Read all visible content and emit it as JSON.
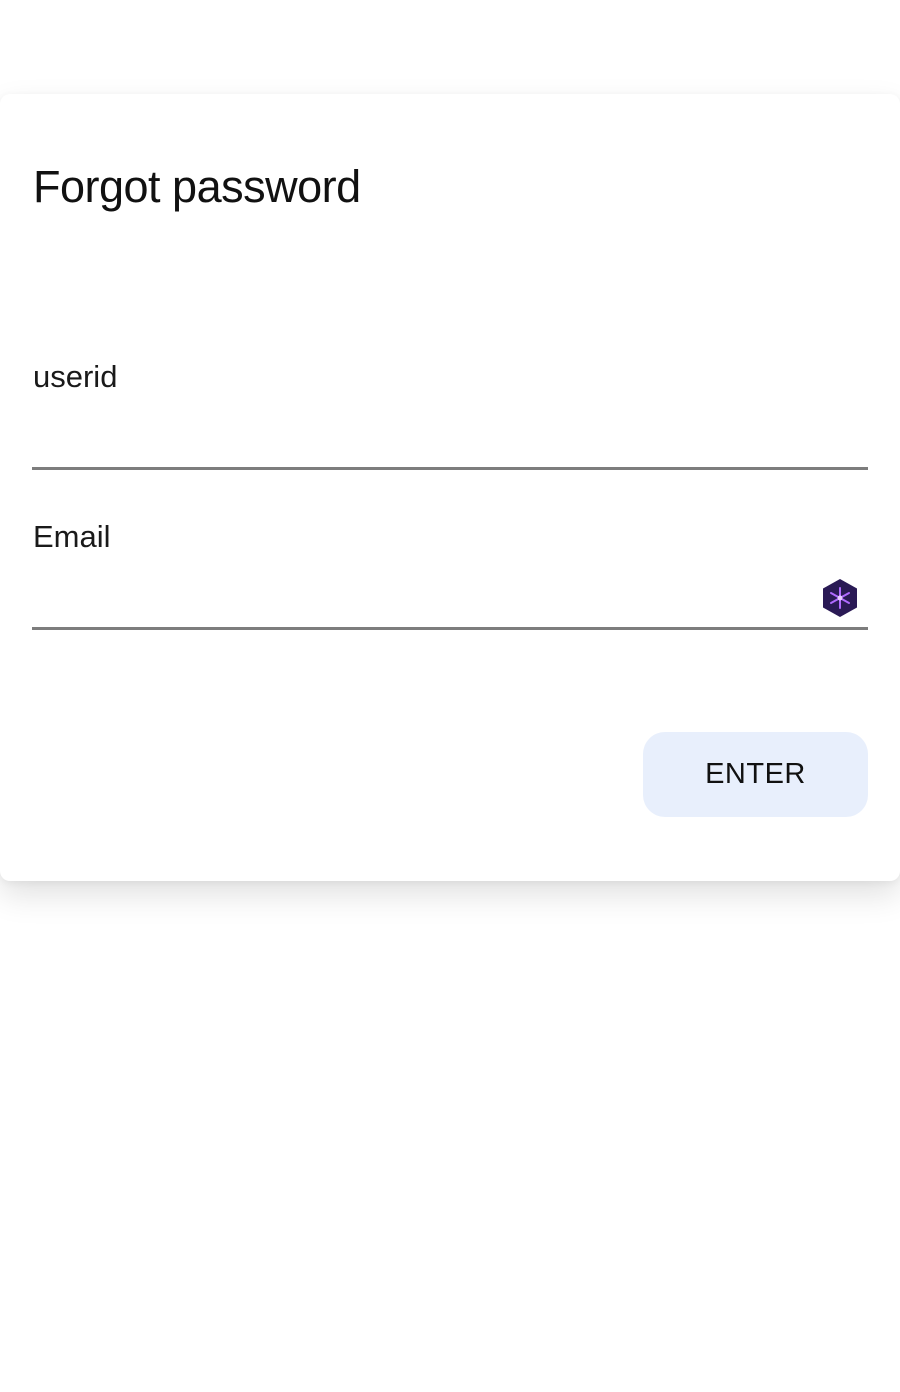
{
  "dialog": {
    "title": "Forgot password",
    "fields": {
      "userid": {
        "label": "userid",
        "value": "",
        "placeholder": ""
      },
      "email": {
        "label": "Email",
        "value": "",
        "placeholder": "",
        "trailing_icon": "password-manager-extension-icon"
      }
    },
    "enter_label": "ENTER"
  },
  "colors": {
    "button_bg": "#e8effc",
    "underline": "#7d7d7d",
    "extension_icon_bg": "#2a1a55",
    "extension_icon_accent": "#b06bff"
  }
}
